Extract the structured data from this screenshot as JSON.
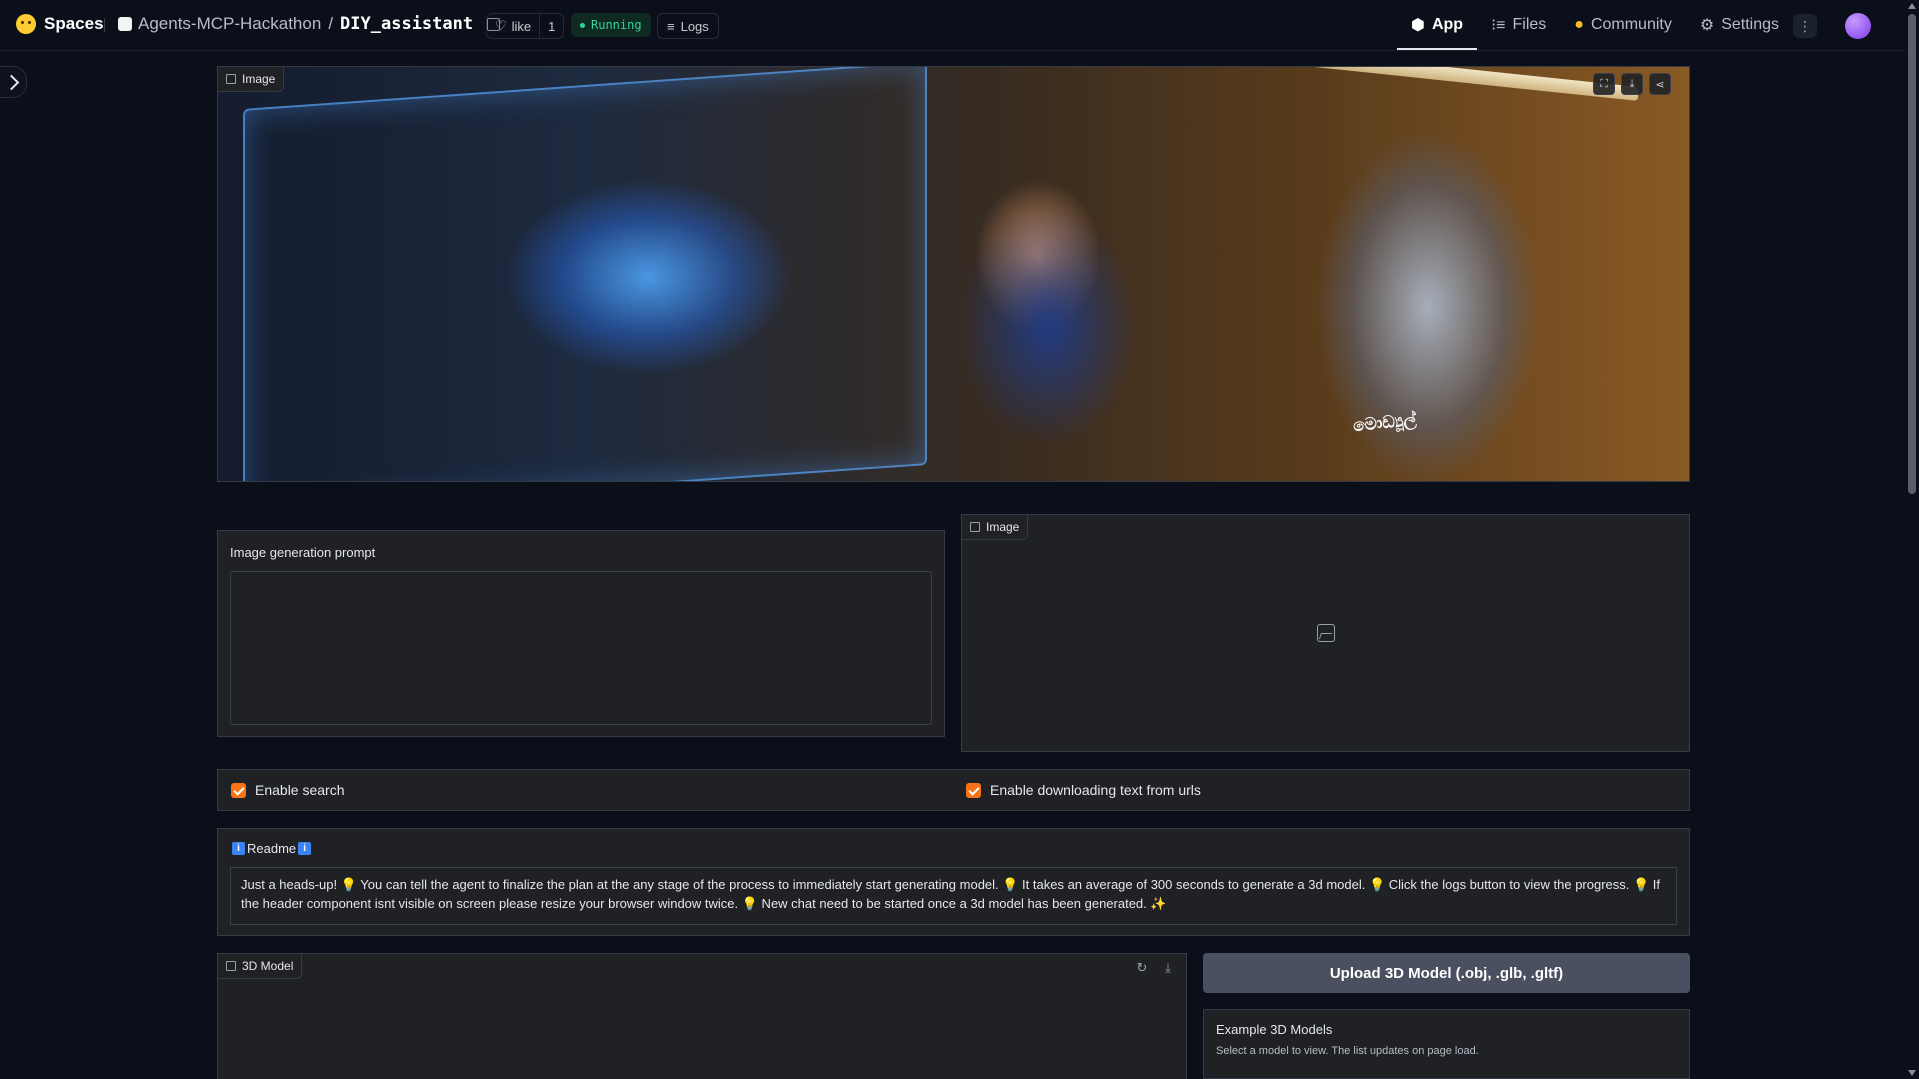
{
  "header": {
    "brand": "Spaces",
    "org": "Agents-MCP-Hackathon",
    "repo": "DIY_assistant",
    "like_label": "like",
    "like_count": "1",
    "status": "Running",
    "logs_label": "Logs",
    "nav": [
      {
        "label": "App",
        "icon": "cube-icon",
        "active": true
      },
      {
        "label": "Files",
        "icon": "files-icon",
        "active": false
      },
      {
        "label": "Community",
        "icon": "community-icon",
        "active": false
      },
      {
        "label": "Settings",
        "icon": "gear-icon",
        "active": false
      }
    ],
    "status_color": "#34d399"
  },
  "hero_image": {
    "label": "Image",
    "overlay_text": "මොඩ්‍යූල්"
  },
  "prompt": {
    "label": "Image generation prompt",
    "value": ""
  },
  "output_image": {
    "label": "Image"
  },
  "options": {
    "enable_search": {
      "label": "Enable search",
      "checked": true
    },
    "enable_download": {
      "label": "Enable downloading text from urls",
      "checked": true
    },
    "accent": "#f97316"
  },
  "readme": {
    "title": "Readme",
    "text": "Just a heads-up! 💡 You can tell the agent to finalize the plan at the any stage of the process to immediately start generating model. 💡 It takes an average of 300 seconds to generate a 3d model. 💡 Click the logs button to view the progress. 💡 If the header component isnt visible on screen please resize your browser window twice. 💡 New chat need to be started once a 3d model has been generated. ✨"
  },
  "model": {
    "label": "3D Model"
  },
  "upload": {
    "label": "Upload 3D Model (.obj, .glb, .gltf)"
  },
  "examples": {
    "title": "Example 3D Models",
    "description": "Select a model to view. The list updates on page load."
  }
}
